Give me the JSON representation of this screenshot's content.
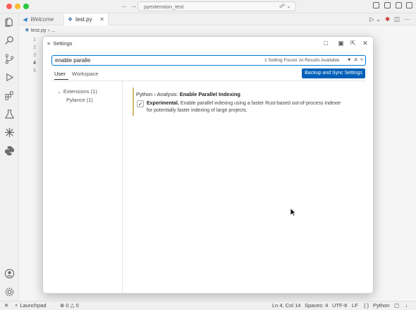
{
  "titlebar": {
    "back_arrow": "←",
    "forward_arrow": "→",
    "search_text": "pyextension_test"
  },
  "tabs": [
    {
      "label": "Welcome",
      "icon": "vscode-logo-icon"
    },
    {
      "label": "test.py",
      "icon": "python-file-icon",
      "close": "✕"
    }
  ],
  "breadcrumb": {
    "file": "test.py",
    "rest": "› ..."
  },
  "editor": {
    "line_numbers": [
      "1",
      "2",
      "3",
      "4",
      "5"
    ],
    "active_line": "4"
  },
  "settings": {
    "title": "Settings",
    "search_value": "enable paralle",
    "search_result": "1 Setting Found. AI Results Available",
    "scope_tabs": [
      "User",
      "Workspace"
    ],
    "sync_button": "Backup and Sync Settings",
    "toc": [
      {
        "label": "Extensions (1)",
        "expanded": true
      },
      {
        "label": "Pylance (1)"
      }
    ],
    "setting": {
      "category": "Python › Analysis: ",
      "name": "Enable Parallel Indexing",
      "checked": true,
      "desc_prefix": "Experimental.",
      "desc_line1": " Enable parallel indexing using a faster Rust-based out-of-process indexer",
      "desc_line2": "for potentially faster indexing of large projects.",
      "accent_color": "#d6b96b"
    }
  },
  "statusbar": {
    "remote": "✕",
    "launchpad": "Launchpad",
    "errors": "0",
    "warnings": "0",
    "position": "Ln 4, Col 14",
    "spaces": "Spaces: 4",
    "encoding": "UTF-8",
    "eol": "LF",
    "language": "Python",
    "language_brackets": "{ }"
  }
}
